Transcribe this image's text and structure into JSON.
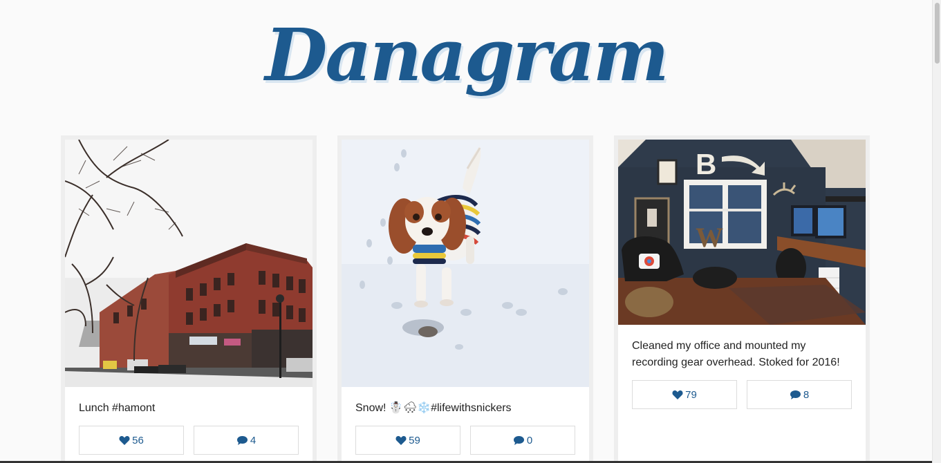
{
  "brand": {
    "logo_text": "Danagram",
    "color": "#1d5a8f"
  },
  "posts": [
    {
      "caption": "Lunch #hamont",
      "likes": "56",
      "comments": "4",
      "photo": "snowy-street-brick-buildings"
    },
    {
      "caption": "Snow! ☃️🌨❄️#lifewithsnickers",
      "likes": "59",
      "comments": "0",
      "photo": "dog-in-striped-sweater-on-snow"
    },
    {
      "caption": "Cleaned my office and mounted my recording gear overhead. Stoked for 2016!",
      "likes": "79",
      "comments": "8",
      "photo": "home-office-with-monitors"
    }
  ],
  "icons": {
    "like": "heart-icon",
    "comment": "comment-bubble-icon"
  }
}
